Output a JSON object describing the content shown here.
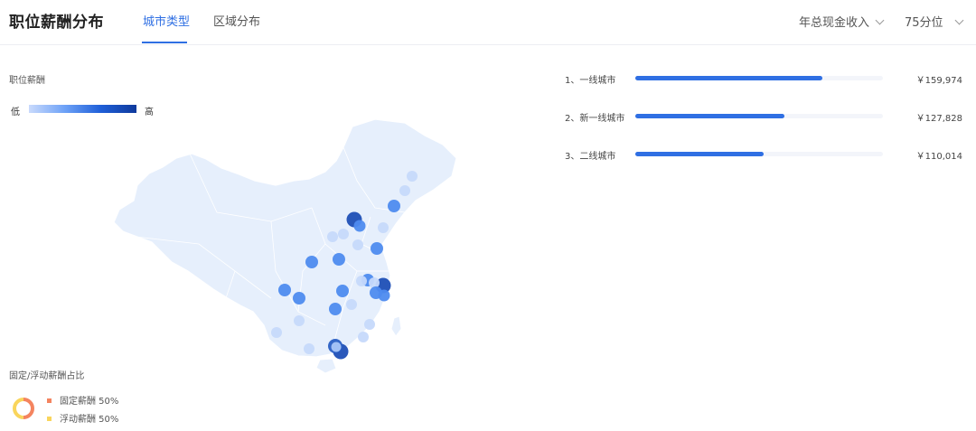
{
  "header": {
    "title": "职位薪酬分布",
    "tabs": [
      {
        "label": "城市类型",
        "active": true
      },
      {
        "label": "区域分布",
        "active": false
      }
    ],
    "filters": [
      {
        "label": "年总现金收入"
      },
      {
        "label": "75分位"
      }
    ]
  },
  "map_panel": {
    "label": "职位薪酬",
    "legend_low": "低",
    "legend_high": "高"
  },
  "ranking": [
    {
      "label": "1、一线城市",
      "value_label": "￥159,974",
      "value": 159974
    },
    {
      "label": "2、新一线城市",
      "value_label": "￥127,828",
      "value": 127828
    },
    {
      "label": "3、二线城市",
      "value_label": "￥110,014",
      "value": 110014
    }
  ],
  "ranking_max": 212000,
  "composition": {
    "label": "固定/浮动薪酬占比",
    "items": [
      {
        "label": "固定薪酬 50%",
        "percent": 50,
        "color": "#f4845f"
      },
      {
        "label": "浮动薪酬 50%",
        "percent": 50,
        "color": "#f9d55c"
      }
    ]
  },
  "colors": {
    "accent": "#2f6fe3",
    "map_fill": "#e6effc",
    "map_stroke": "#ffffff"
  }
}
